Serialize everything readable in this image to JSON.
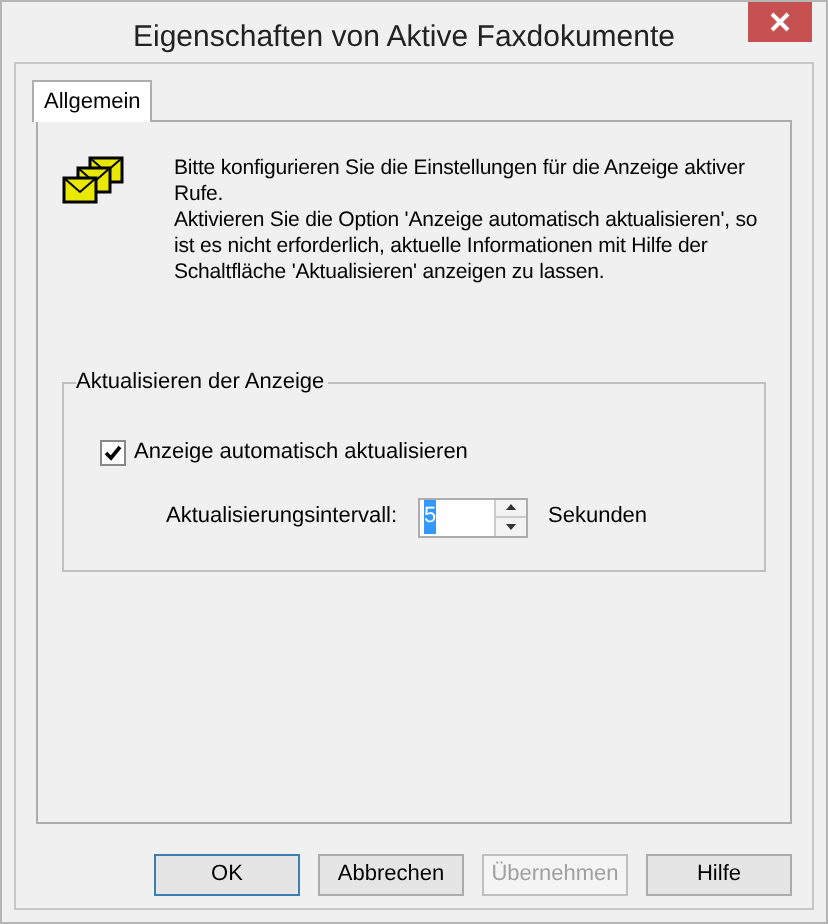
{
  "window": {
    "title": "Eigenschaften von Aktive Faxdokumente"
  },
  "tabs": [
    {
      "label": "Allgemein",
      "selected": true
    }
  ],
  "description": [
    "Bitte konfigurieren Sie die Einstellungen für die Anzeige aktiver Rufe.",
    "Aktivieren Sie die Option 'Anzeige automatisch aktualisieren', so ist es nicht erforderlich, aktuelle Informationen mit Hilfe der Schaltfläche 'Aktualisieren' anzeigen zu lassen."
  ],
  "group": {
    "title": "Aktualisieren der Anzeige",
    "checkbox": {
      "label": "Anzeige automatisch aktualisieren",
      "checked": true
    },
    "interval": {
      "label": "Aktualisierungsintervall:",
      "value": "5",
      "unit": "Sekunden"
    }
  },
  "buttons": [
    {
      "label": "OK",
      "default": true,
      "disabled": false
    },
    {
      "label": "Abbrechen",
      "default": false,
      "disabled": false
    },
    {
      "label": "Übernehmen",
      "default": false,
      "disabled": true
    },
    {
      "label": "Hilfe",
      "default": false,
      "disabled": false
    }
  ]
}
